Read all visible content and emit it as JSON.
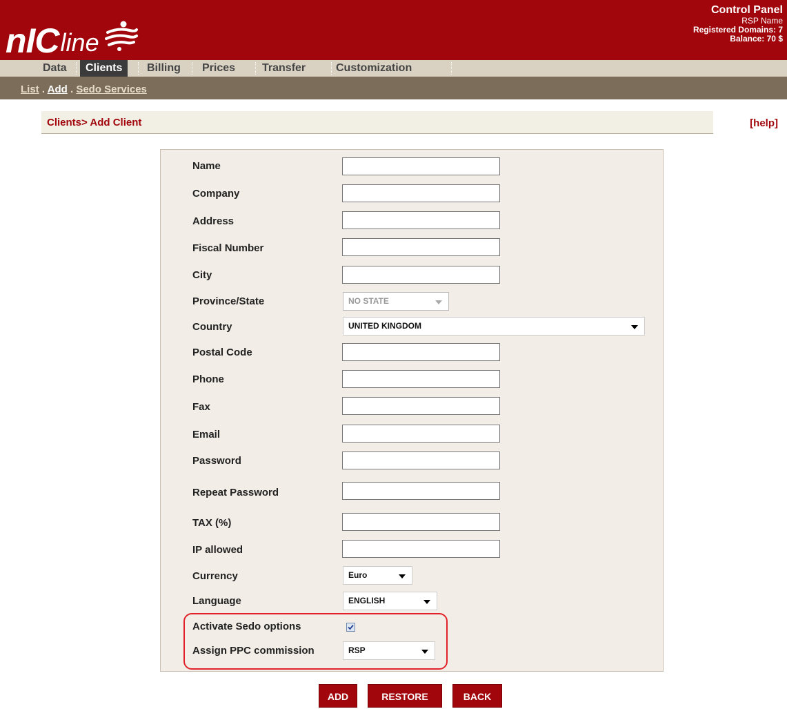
{
  "header": {
    "logo_nic": "nIC",
    "logo_line": "line",
    "control_panel": "Control Panel",
    "rsp_name": "RSP Name",
    "registered_domains": "Registered Domains: 7",
    "balance": "Balance: 70 $",
    "brand_color": "#a0060b"
  },
  "nav": {
    "items": [
      {
        "label": "Data"
      },
      {
        "label": "Clients",
        "active": true
      },
      {
        "label": "Billing"
      },
      {
        "label": "Prices"
      },
      {
        "label": "Transfer"
      },
      {
        "label": "Customization"
      }
    ]
  },
  "subnav": {
    "items": [
      {
        "label": "List"
      },
      {
        "label": "Add",
        "active": true
      },
      {
        "label": "Sedo Services"
      }
    ],
    "separator": "."
  },
  "breadcrumb": "Clients> Add Client",
  "help": "[help]",
  "form": {
    "fields": {
      "name": {
        "label": "Name",
        "value": ""
      },
      "company": {
        "label": "Company",
        "value": ""
      },
      "address": {
        "label": "Address",
        "value": ""
      },
      "fiscal_number": {
        "label": "Fiscal Number",
        "value": ""
      },
      "city": {
        "label": "City",
        "value": ""
      },
      "province_state": {
        "label": "Province/State",
        "value": "NO STATE",
        "disabled": true
      },
      "country": {
        "label": "Country",
        "value": "UNITED KINGDOM"
      },
      "postal_code": {
        "label": "Postal Code",
        "value": ""
      },
      "phone": {
        "label": "Phone",
        "value": ""
      },
      "fax": {
        "label": "Fax",
        "value": ""
      },
      "email": {
        "label": "Email",
        "value": ""
      },
      "password": {
        "label": "Password",
        "value": ""
      },
      "repeat_password": {
        "label": "Repeat Password",
        "value": ""
      },
      "tax": {
        "label": "TAX (%)",
        "value": ""
      },
      "ip_allowed": {
        "label": "IP allowed",
        "value": ""
      },
      "currency": {
        "label": "Currency",
        "value": "Euro"
      },
      "language": {
        "label": "Language",
        "value": "ENGLISH"
      },
      "activate_sedo": {
        "label": "Activate Sedo options",
        "checked": true
      },
      "ppc_commission": {
        "label": "Assign PPC commission",
        "value": "RSP"
      }
    }
  },
  "buttons": {
    "add": "ADD",
    "restore": "RESTORE",
    "back": "BACK"
  }
}
